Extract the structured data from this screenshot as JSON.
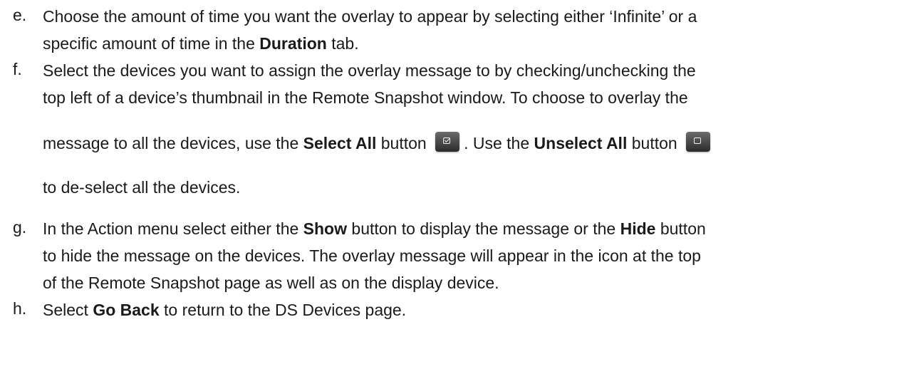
{
  "items": {
    "e": {
      "marker": "e.",
      "line1": "Choose the amount of time you want the overlay to appear by selecting either ‘Infinite’ or a",
      "line2_pre": "specific amount of time in the ",
      "line2_bold": "Duration",
      "line2_post": " tab."
    },
    "f": {
      "marker": "f.",
      "line1": "Select the devices you want to assign the overlay message to by checking/unchecking the",
      "line2": "top left of a device’s thumbnail in the Remote Snapshot window. To choose to overlay the",
      "line3_pre": "message to all the devices, use the ",
      "select_all": "Select All",
      "line3_mid1": " button",
      "line3_mid2": ". Use the ",
      "unselect_all": "Unselect All",
      "line3_post": " button",
      "line4": "to de-select all the devices.",
      "select_all_icon": "checkbox-checked-icon",
      "unselect_all_icon": "checkbox-empty-icon"
    },
    "g": {
      "marker": "g.",
      "line1_pre": "In the Action menu select either the ",
      "show": "Show",
      "line1_mid": " button to display the message or the ",
      "hide": "Hide",
      "line1_post": " button",
      "line2": "to hide the message on the devices. The overlay message will appear in the icon at the top",
      "line3": "of the Remote Snapshot page as well as on the display device."
    },
    "h": {
      "marker": "h.",
      "line1_pre": "Select ",
      "go_back": "Go Back",
      "line1_post": " to return to the DS Devices page."
    }
  }
}
